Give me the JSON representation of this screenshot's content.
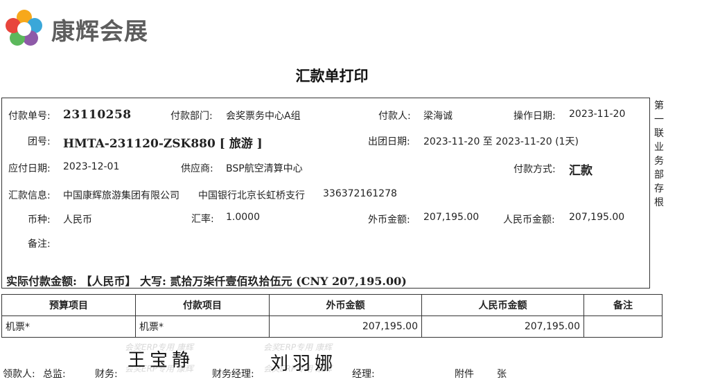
{
  "brand": {
    "logo_text": "康辉会展",
    "colors": [
      "#e8453c",
      "#f7a81b",
      "#5cb85c",
      "#3aa7d9",
      "#8e5aa8"
    ]
  },
  "title": "汇款单打印",
  "fields": {
    "voucher_no": {
      "label": "付款单号:",
      "value": "23110258"
    },
    "department": {
      "label": "付款部门:",
      "value": "会奖票务中心A组"
    },
    "payer": {
      "label": "付款人:",
      "value": "梁海诚"
    },
    "op_date": {
      "label": "操作日期:",
      "value": "2023-11-20"
    },
    "group_no": {
      "label": "团号:",
      "value": "HMTA-231120-ZSK880 [ 旅游 ]"
    },
    "depart_date": {
      "label": "出团日期:",
      "value": "2023-11-20 至 2023-11-20 (1天)"
    },
    "due_date": {
      "label": "应付日期:",
      "value": "2023-12-01"
    },
    "supplier": {
      "label": "供应商:",
      "value": "BSP航空清算中心"
    },
    "pay_method": {
      "label": "付款方式:",
      "value": "汇款"
    },
    "remit_info": {
      "label": "汇款信息:",
      "company": "中国康辉旅游集团有限公司",
      "bank": "中国银行北京长虹桥支行",
      "account": "336372161278"
    },
    "currency": {
      "label": "币种:",
      "value": "人民币"
    },
    "rate": {
      "label": "汇率:",
      "value": "1.0000"
    },
    "foreign_amount": {
      "label": "外币金额:",
      "value": "207,195.00"
    },
    "rmb_amount": {
      "label": "人民币金额:",
      "value": "207,195.00"
    },
    "remark": {
      "label": "备注:",
      "value": ""
    }
  },
  "actual_payment": "实际付款金额: 【人民币】 大写: 贰拾万柒仟壹佰玖拾伍元 (CNY 207,195.00)",
  "side_note": "第一联业务部存根",
  "table": {
    "headers": [
      "预算项目",
      "付款项目",
      "外币金额",
      "人民币金额",
      "备注"
    ],
    "rows": [
      [
        "机票*",
        "机票*",
        "207,195.00",
        "207,195.00",
        ""
      ]
    ]
  },
  "watermarks": [
    "会奖ERP专用 康辉",
    "会奖ERP专用 康辉",
    "会奖ERP专用 康辉",
    "会奖ERP专用 康辉"
  ],
  "signatures": [
    "王宝静",
    "刘羽娜"
  ],
  "footer": {
    "receiver": "领款人:",
    "director": "总监:",
    "finance": "财务:",
    "finance_manager": "财务经理:",
    "manager": "经理:",
    "attachment": "附件",
    "sheets": "张"
  }
}
